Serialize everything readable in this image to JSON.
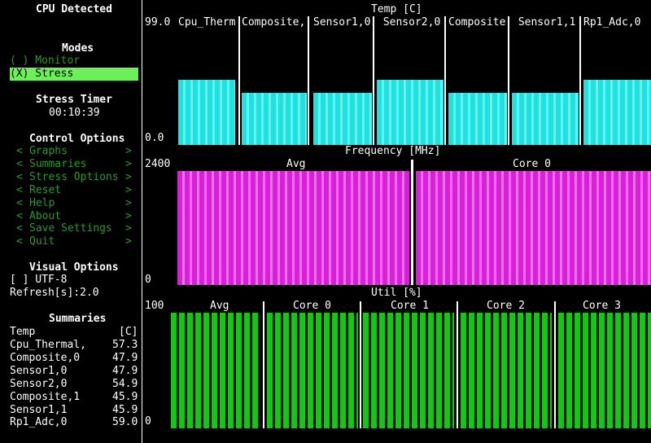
{
  "sidebar": {
    "cpu_header": "CPU Detected",
    "modes_header": "Modes",
    "mode_monitor": "( ) Monitor",
    "mode_stress": "(X) Stress",
    "stress_timer_header": "Stress Timer",
    "stress_timer_value": "00:10:39",
    "control_header": "Control Options",
    "controls": [
      "Graphs",
      "Summaries",
      "Stress Options",
      "Reset",
      "Help",
      "About",
      "Save Settings",
      "Quit"
    ],
    "control_left": "<",
    "control_right": ">",
    "visual_header": "Visual Options",
    "utf8": "[ ] UTF-8",
    "refresh": "Refresh[s]:2.0",
    "summaries_header": "Summaries",
    "summary_head_label": "Temp",
    "summary_head_unit": "[C]",
    "summaries": [
      {
        "label": "Cpu_Thermal,",
        "value": "57.3"
      },
      {
        "label": "Composite,0",
        "value": "47.9"
      },
      {
        "label": "Sensor1,0",
        "value": "47.9"
      },
      {
        "label": "Sensor2,0",
        "value": "54.9"
      },
      {
        "label": "Composite,1",
        "value": "45.9"
      },
      {
        "label": "Sensor1,1",
        "value": "45.9"
      },
      {
        "label": "Rp1_Adc,0",
        "value": "59.0"
      }
    ]
  },
  "temp": {
    "title": "Temp [C]",
    "ymax": "99.0",
    "ymin": "0.0",
    "labels": [
      "Cpu_Therm",
      "Composite,",
      "Sensor1,0",
      " Sensor2,0",
      "Composite",
      " Sensor1,1",
      "Rp1_Adc,0"
    ]
  },
  "freq": {
    "title": "Frequency [MHz]",
    "ymax": "2400",
    "ymin": "0",
    "labels": [
      "Avg",
      "Core 0"
    ]
  },
  "util": {
    "title": "Util [%]",
    "ymax": "100",
    "ymin": "0",
    "labels": [
      "Avg",
      "Core 0",
      "Core 1",
      "Core 2",
      "Core 3"
    ]
  }
}
